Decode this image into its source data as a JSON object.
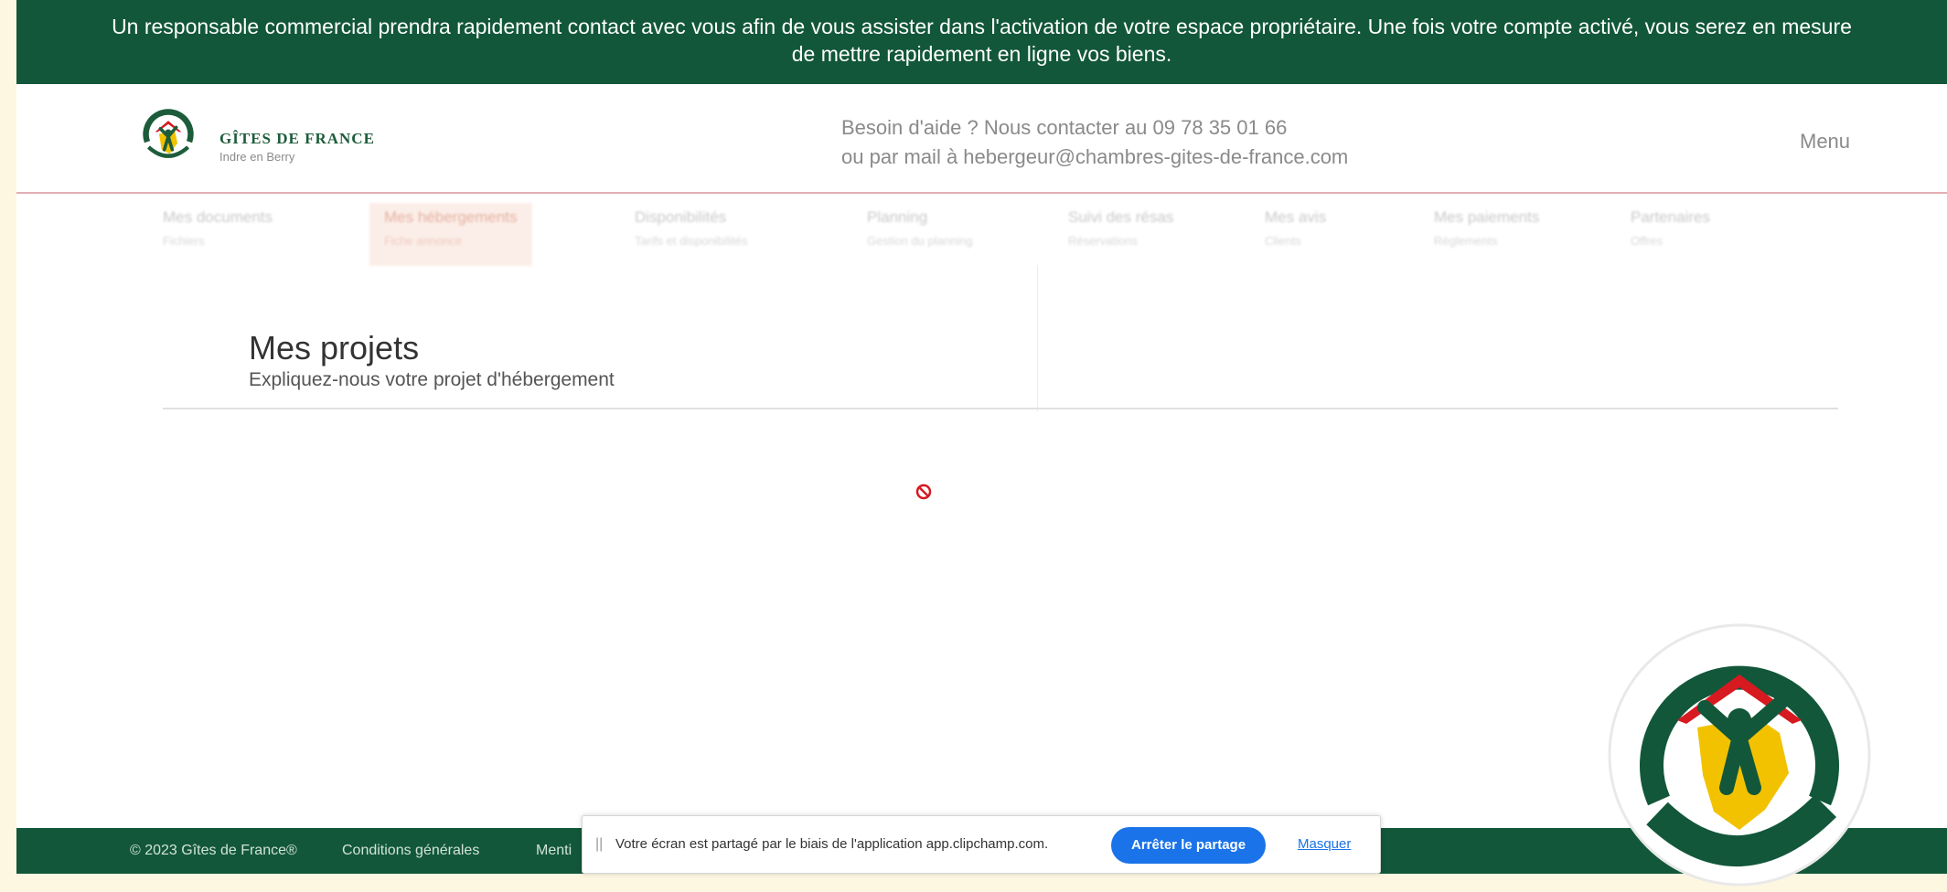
{
  "banner": {
    "line1": "Un responsable commercial prendra rapidement contact avec vous afin de vous assister dans l'activation de votre espace propriétaire. Une fois votre compte activé, vous serez en mesure",
    "line2": "de mettre rapidement en ligne vos biens."
  },
  "header": {
    "brand_name": "GÎTES DE FRANCE",
    "brand_region": "Indre en Berry",
    "help_line1": "Besoin d'aide ? Nous contacter au 09 78 35 01 66",
    "help_line2": "ou par mail à hebergeur@chambres-gites-de-france.com",
    "menu_label": "Menu"
  },
  "nav": {
    "items": [
      {
        "label": "Mes documents",
        "sub": "Fichiers"
      },
      {
        "label": "Mes hébergements",
        "sub": "Fiche annonce"
      },
      {
        "label": "Disponibilités",
        "sub": "Tarifs et disponibilités"
      },
      {
        "label": "Planning",
        "sub": "Gestion du planning"
      },
      {
        "label": "Suivi des résas",
        "sub": "Réservations"
      },
      {
        "label": "Mes avis",
        "sub": "Clients"
      },
      {
        "label": "Mes paiements",
        "sub": "Règlements"
      },
      {
        "label": "Partenaires",
        "sub": "Offres"
      }
    ],
    "active_index": 1
  },
  "main": {
    "title": "Mes projets",
    "subtitle": "Expliquez-nous votre projet d'hébergement"
  },
  "footer": {
    "copyright": "© 2023 Gîtes de France®",
    "conditions": "Conditions générales",
    "mentions": "Menti"
  },
  "share_bar": {
    "message": "Votre écran est partagé par le biais de l'application app.clipchamp.com.",
    "stop_label": "Arrêter le partage",
    "hide_label": "Masquer"
  },
  "colors": {
    "brand_green": "#12573a",
    "logo_yellow": "#f2c200",
    "roof_red": "#d71920",
    "share_blue": "#1a73e8"
  }
}
